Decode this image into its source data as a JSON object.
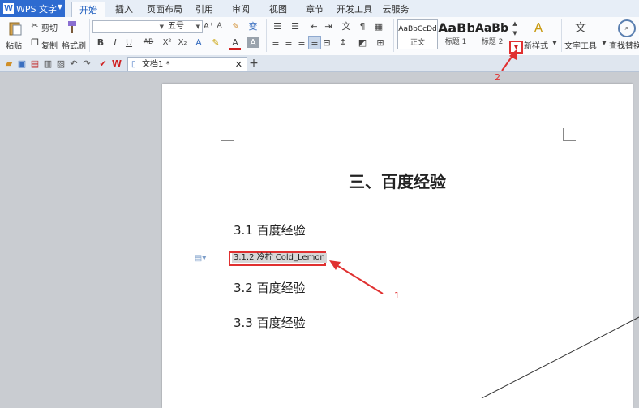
{
  "app": {
    "name": "WPS 文字",
    "logo_letter": "W"
  },
  "tabs": [
    "开始",
    "插入",
    "页面布局",
    "引用",
    "审阅",
    "视图",
    "章节",
    "开发工具",
    "云服务"
  ],
  "active_tab": "开始",
  "ribbon": {
    "paste": "粘贴",
    "cut": "剪切",
    "copy": "复制",
    "format_painter": "格式刷",
    "font_name": "",
    "font_size": "五号",
    "bold": "B",
    "italic": "I",
    "underline": "U",
    "strike_ab": "AB",
    "superscript": "X²",
    "subscript": "X₂",
    "styles": [
      {
        "sample": "AaBbCcDd",
        "caption": "正文"
      },
      {
        "sample": "AaBb",
        "caption": "标题 1"
      },
      {
        "sample": "AaBb(",
        "caption": "标题 2"
      }
    ],
    "new_style": "新样式",
    "text_tools": "文字工具",
    "find_replace": "查找替换"
  },
  "doc_tab": {
    "title": "文档1 *"
  },
  "document": {
    "heading": "三、百度经验",
    "items": [
      "3.1 百度经验",
      "3.1.2 冷柠 Cold_Lemon",
      "3.2 百度经验",
      "3.3 百度经验"
    ]
  },
  "annotations": {
    "label_1": "1",
    "label_2": "2",
    "color": "#e03030"
  }
}
